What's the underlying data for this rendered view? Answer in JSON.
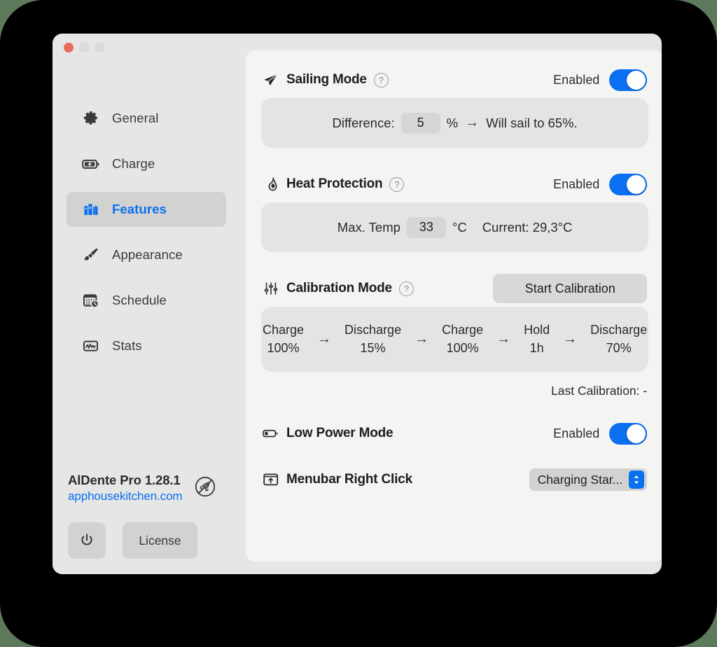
{
  "window": {
    "traffic_lights": [
      "close",
      "minimize",
      "maximize"
    ]
  },
  "sidebar": {
    "items": [
      {
        "label": "General",
        "icon": "gear-icon",
        "active": false
      },
      {
        "label": "Charge",
        "icon": "battery-bolt-icon",
        "active": false
      },
      {
        "label": "Features",
        "icon": "books-icon",
        "active": true
      },
      {
        "label": "Appearance",
        "icon": "paintbrush-icon",
        "active": false
      },
      {
        "label": "Schedule",
        "icon": "calendar-clock-icon",
        "active": false
      },
      {
        "label": "Stats",
        "icon": "chart-box-icon",
        "active": false
      }
    ],
    "footer": {
      "app_name": "AlDente Pro 1.28.1",
      "website": "apphousekitchen.com",
      "rocket_icon": "rocket-slash-icon",
      "power_icon": "power-icon",
      "license_label": "License"
    }
  },
  "main": {
    "sailing": {
      "icon": "paper-plane-icon",
      "title": "Sailing Mode",
      "help": "?",
      "toggle_label": "Enabled",
      "toggle_on": true,
      "difference_label": "Difference:",
      "difference_value": "5",
      "percent_unit": "%",
      "arrow": "→",
      "result_text": "Will sail to 65%."
    },
    "heat": {
      "icon": "flame-icon",
      "title": "Heat Protection",
      "help": "?",
      "toggle_label": "Enabled",
      "toggle_on": true,
      "max_temp_label": "Max. Temp",
      "max_temp_value": "33",
      "temp_unit": "°C",
      "current_text": "Current: 29,3°C"
    },
    "calibration": {
      "icon": "sliders-icon",
      "title": "Calibration Mode",
      "help": "?",
      "start_button": "Start Calibration",
      "steps": [
        {
          "action": "Charge",
          "value": "100%"
        },
        {
          "action": "Discharge",
          "value": "15%"
        },
        {
          "action": "Charge",
          "value": "100%"
        },
        {
          "action": "Hold",
          "value": "1h"
        },
        {
          "action": "Discharge",
          "value": "70%"
        }
      ],
      "arrow": "→",
      "last_calibration": "Last Calibration: -"
    },
    "low_power": {
      "icon": "battery-low-icon",
      "title": "Low Power Mode",
      "toggle_label": "Enabled",
      "toggle_on": true
    },
    "menubar": {
      "icon": "menubar-icon",
      "title": "Menubar Right Click",
      "selected": "Charging Star...",
      "stepper_icon": "chevron-updown-icon"
    }
  },
  "colors": {
    "accent": "#0a6ff0",
    "window_bg": "#e6e6e4",
    "card_bg": "#f4f4f2",
    "panel_bg": "#e4e4e2",
    "close_red": "#ec6a5e",
    "desktop": "#000000"
  }
}
